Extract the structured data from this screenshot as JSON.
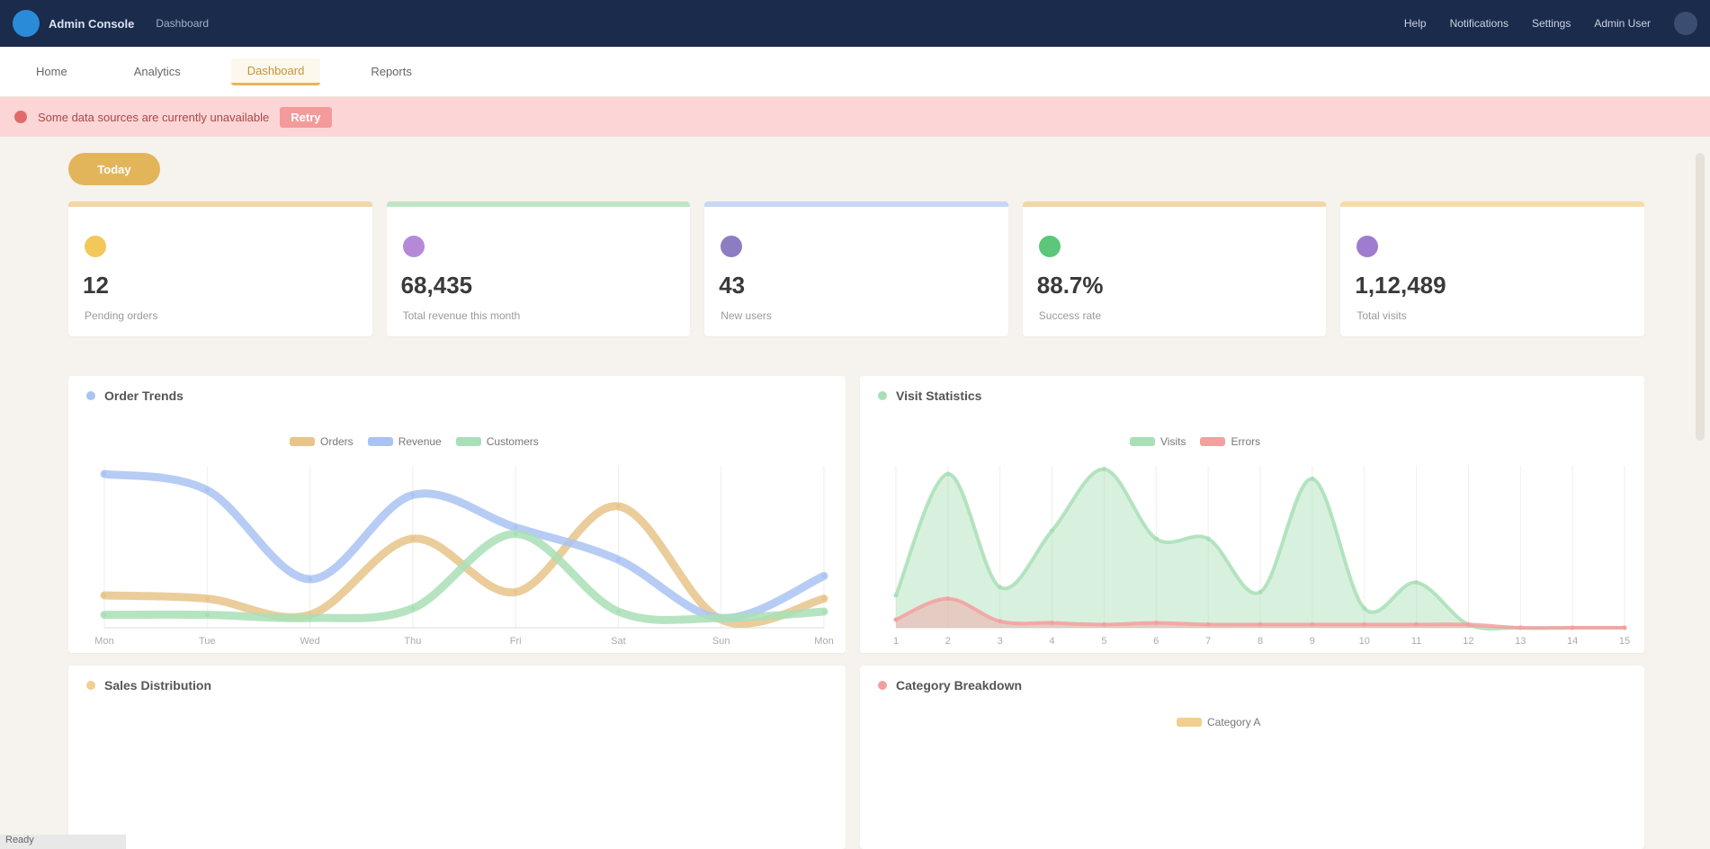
{
  "app": {
    "brand_name": "Admin Console",
    "breadcrumb": "Dashboard"
  },
  "topbar": {
    "right_items": [
      "Help",
      "Notifications",
      "Settings",
      "Admin User"
    ]
  },
  "tabs": [
    {
      "label": "Home",
      "active": false
    },
    {
      "label": "Analytics",
      "active": false
    },
    {
      "label": "Dashboard",
      "active": true
    },
    {
      "label": "Reports",
      "active": false
    }
  ],
  "alert": {
    "text": "Some data sources are currently unavailable",
    "link": "Retry"
  },
  "period": {
    "label": "Today"
  },
  "kpis": [
    {
      "value": "12",
      "label": "Pending orders",
      "icon": "star-icon",
      "color": "#f3c85a",
      "accent": "#f2d7a7"
    },
    {
      "value": "68,435",
      "label": "Total revenue this month",
      "icon": "purple-dot-icon",
      "color": "#b48ad8",
      "accent": "#bfe6c3"
    },
    {
      "value": "43",
      "label": "New users",
      "icon": "user-icon",
      "color": "#8e7cc3",
      "accent": "#c7d7f5"
    },
    {
      "value": "88.7%",
      "label": "Success rate",
      "icon": "check-icon",
      "color": "#5cc77a",
      "accent": "#f2d7a7"
    },
    {
      "value": "1,12,489",
      "label": "Total visits",
      "icon": "chart-icon",
      "color": "#9f7ccf",
      "accent": "#f6dca8"
    }
  ],
  "colors": {
    "orange": "#e8c48a",
    "blue": "#a9c3f2",
    "green": "#a9dfb6",
    "red": "#f4a0a0"
  },
  "panels": {
    "trend_title": "Order Trends",
    "activity_title": "Visit Statistics",
    "bottom_left_title": "Sales Distribution",
    "bottom_right_title": "Category Breakdown",
    "bottom_right_legend": "Category A"
  },
  "chart_data": [
    {
      "type": "line",
      "title": "Order Trends",
      "categories": [
        "Mon",
        "Tue",
        "Wed",
        "Thu",
        "Fri",
        "Sat",
        "Sun",
        "Mon"
      ],
      "ylim": [
        0,
        100
      ],
      "grid": true,
      "legend_position": "top-center",
      "series": [
        {
          "name": "Orders",
          "color": "#e8c48a",
          "values": [
            20,
            18,
            8,
            55,
            22,
            75,
            5,
            18
          ]
        },
        {
          "name": "Revenue",
          "color": "#a9c3f2",
          "values": [
            95,
            85,
            30,
            82,
            62,
            42,
            6,
            32
          ]
        },
        {
          "name": "Customers",
          "color": "#a9dfb6",
          "values": [
            8,
            8,
            6,
            12,
            58,
            10,
            6,
            10
          ]
        }
      ]
    },
    {
      "type": "area",
      "title": "Visit Statistics",
      "categories": [
        "1",
        "2",
        "3",
        "4",
        "5",
        "6",
        "7",
        "8",
        "9",
        "10",
        "11",
        "12",
        "13",
        "14",
        "15"
      ],
      "ylim": [
        0,
        100
      ],
      "grid": true,
      "legend_position": "top-center",
      "series": [
        {
          "name": "Visits",
          "color": "#a9dfb6",
          "values": [
            20,
            95,
            25,
            60,
            98,
            55,
            55,
            22,
            92,
            12,
            28,
            2,
            0,
            0,
            0
          ]
        },
        {
          "name": "Errors",
          "color": "#f4a0a0",
          "values": [
            5,
            18,
            4,
            3,
            2,
            3,
            2,
            2,
            2,
            2,
            2,
            2,
            0,
            0,
            0
          ]
        }
      ]
    }
  ],
  "status_bar": "Ready"
}
